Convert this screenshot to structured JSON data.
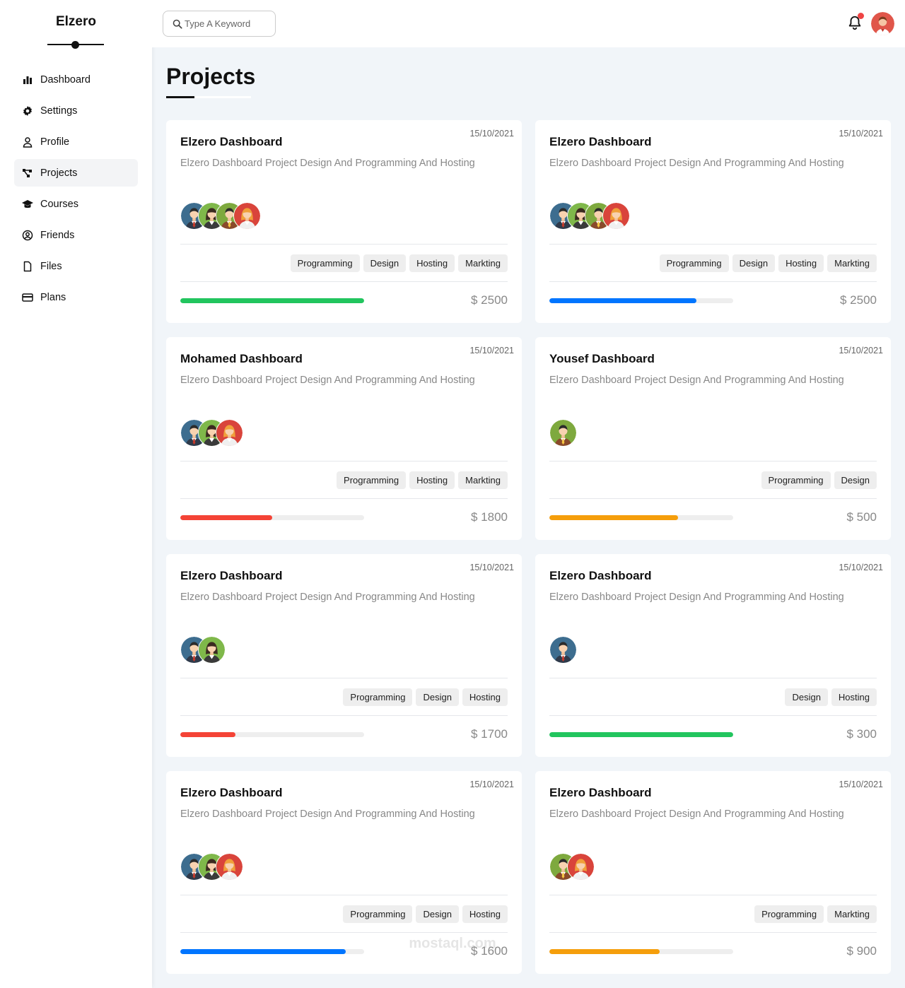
{
  "sidebar": {
    "brand": "Elzero",
    "items": [
      {
        "label": "Dashboard",
        "icon": "chart-bar-icon",
        "active": false
      },
      {
        "label": "Settings",
        "icon": "gear-icon",
        "active": false
      },
      {
        "label": "Profile",
        "icon": "user-icon",
        "active": false
      },
      {
        "label": "Projects",
        "icon": "diagram-project-icon",
        "active": true
      },
      {
        "label": "Courses",
        "icon": "graduation-cap-icon",
        "active": false
      },
      {
        "label": "Friends",
        "icon": "user-circle-icon",
        "active": false
      },
      {
        "label": "Files",
        "icon": "file-icon",
        "active": false
      },
      {
        "label": "Plans",
        "icon": "credit-card-icon",
        "active": false
      }
    ]
  },
  "header": {
    "search_placeholder": "Type A Keyword",
    "notification_icon": "bell-icon",
    "notification_dot_color": "#ef4444"
  },
  "page": {
    "title": "Projects"
  },
  "projects": [
    {
      "name": "Elzero Dashboard",
      "date": "15/10/2021",
      "description": "Elzero Dashboard Project Design And Programming And Hosting",
      "avatars": [
        "blue",
        "green",
        "olive",
        "red"
      ],
      "tags": [
        "Programming",
        "Design",
        "Hosting",
        "Markting"
      ],
      "progress": 1.0,
      "color": "#22c55e",
      "price": "$ 2500"
    },
    {
      "name": "Elzero Dashboard",
      "date": "15/10/2021",
      "description": "Elzero Dashboard Project Design And Programming And Hosting",
      "avatars": [
        "blue",
        "green",
        "olive",
        "red"
      ],
      "tags": [
        "Programming",
        "Design",
        "Hosting",
        "Markting"
      ],
      "progress": 0.8,
      "color": "#0075ff",
      "price": "$ 2500"
    },
    {
      "name": "Mohamed Dashboard",
      "date": "15/10/2021",
      "description": "Elzero Dashboard Project Design And Programming And Hosting",
      "avatars": [
        "blue",
        "green",
        "red"
      ],
      "tags": [
        "Programming",
        "Hosting",
        "Markting"
      ],
      "progress": 0.5,
      "color": "#f44336",
      "price": "$ 1800"
    },
    {
      "name": "Yousef Dashboard",
      "date": "15/10/2021",
      "description": "Elzero Dashboard Project Design And Programming And Hosting",
      "avatars": [
        "olive"
      ],
      "tags": [
        "Programming",
        "Design"
      ],
      "progress": 0.7,
      "color": "#f59e0b",
      "price": "$ 500"
    },
    {
      "name": "Elzero Dashboard",
      "date": "15/10/2021",
      "description": "Elzero Dashboard Project Design And Programming And Hosting",
      "avatars": [
        "blue",
        "green"
      ],
      "tags": [
        "Programming",
        "Design",
        "Hosting"
      ],
      "progress": 0.3,
      "color": "#f44336",
      "price": "$ 1700"
    },
    {
      "name": "Elzero Dashboard",
      "date": "15/10/2021",
      "description": "Elzero Dashboard Project Design And Programming And Hosting",
      "avatars": [
        "blue"
      ],
      "tags": [
        "Design",
        "Hosting"
      ],
      "progress": 1.0,
      "color": "#22c55e",
      "price": "$ 300"
    },
    {
      "name": "Elzero Dashboard",
      "date": "15/10/2021",
      "description": "Elzero Dashboard Project Design And Programming And Hosting",
      "avatars": [
        "blue",
        "green",
        "red"
      ],
      "tags": [
        "Programming",
        "Design",
        "Hosting"
      ],
      "progress": 0.9,
      "color": "#0075ff",
      "price": "$ 1600"
    },
    {
      "name": "Elzero Dashboard",
      "date": "15/10/2021",
      "description": "Elzero Dashboard Project Design And Programming And Hosting",
      "avatars": [
        "olive",
        "red"
      ],
      "tags": [
        "Programming",
        "Markting"
      ],
      "progress": 0.6,
      "color": "#f59e0b",
      "price": "$ 900"
    }
  ],
  "watermark": {
    "text": "mostaql.com"
  }
}
